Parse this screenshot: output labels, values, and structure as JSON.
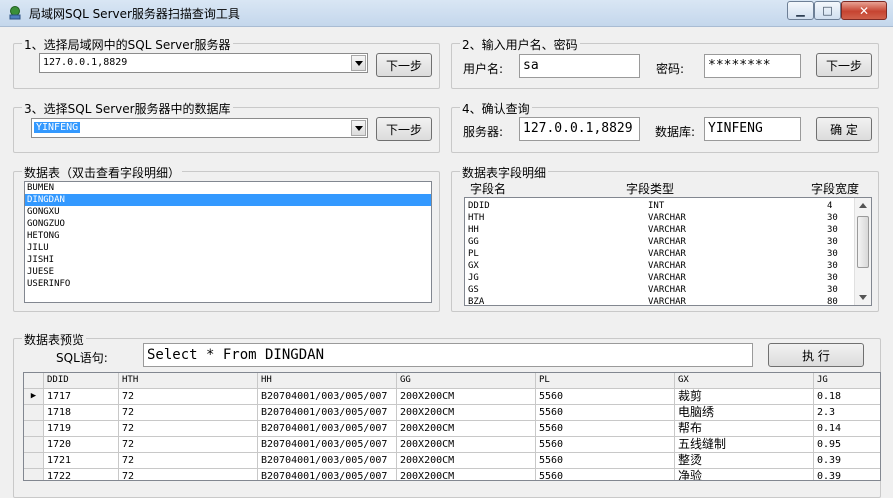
{
  "window": {
    "title": "局域网SQL Server服务器扫描查询工具",
    "min_glyph": "▁",
    "max_glyph": "□",
    "close_glyph": "✕"
  },
  "step1": {
    "label": "1、选择局域网中的SQL Server服务器",
    "server_value": "127.0.0.1,8829",
    "next_label": "下一步"
  },
  "step2": {
    "label": "2、输入用户名、密码",
    "user_label": "用户名:",
    "user_value": "sa",
    "pwd_label": "密码:",
    "pwd_value": "********",
    "next_label": "下一步"
  },
  "step3": {
    "label": "3、选择SQL Server服务器中的数据库",
    "db_value": "YINFENG",
    "next_label": "下一步"
  },
  "step4": {
    "label": "4、确认查询",
    "server_label": "服务器:",
    "server_value": "127.0.0.1,8829",
    "db_label": "数据库:",
    "db_value": "YINFENG",
    "confirm_label": "确 定"
  },
  "tables": {
    "label": "数据表（双击查看字段明细）",
    "items": [
      "BUMEN",
      "DINGDAN",
      "GONGXU",
      "GONGZUO",
      "HETONG",
      "JILU",
      "JISHI",
      "JUESE",
      "USERINFO"
    ],
    "selected": "DINGDAN"
  },
  "fields": {
    "label": "数据表字段明细",
    "headers": [
      "字段名",
      "字段类型",
      "字段宽度"
    ],
    "rows": [
      [
        "DDID",
        "INT",
        "4"
      ],
      [
        "HTH",
        "VARCHAR",
        "30"
      ],
      [
        "HH",
        "VARCHAR",
        "30"
      ],
      [
        "GG",
        "VARCHAR",
        "30"
      ],
      [
        "PL",
        "VARCHAR",
        "30"
      ],
      [
        "GX",
        "VARCHAR",
        "30"
      ],
      [
        "JG",
        "VARCHAR",
        "30"
      ],
      [
        "GS",
        "VARCHAR",
        "30"
      ],
      [
        "BZA",
        "VARCHAR",
        "80"
      ]
    ]
  },
  "preview": {
    "label": "数据表预览",
    "sql_label": "SQL语句:",
    "sql_value": "Select * From DINGDAN",
    "execute_label": "执 行",
    "current_row_marker": "▶",
    "columns": [
      "DDID",
      "HTH",
      "HH",
      "GG",
      "PL",
      "GX",
      "JG"
    ],
    "rows": [
      [
        "1717",
        "72",
        "B20704001/003/005/007",
        "200X200CM",
        "5560",
        "裁剪",
        "0.18"
      ],
      [
        "1718",
        "72",
        "B20704001/003/005/007",
        "200X200CM",
        "5560",
        "电脑绣",
        "2.3"
      ],
      [
        "1719",
        "72",
        "B20704001/003/005/007",
        "200X200CM",
        "5560",
        "帮布",
        "0.14"
      ],
      [
        "1720",
        "72",
        "B20704001/003/005/007",
        "200X200CM",
        "5560",
        "五线缝制",
        "0.95"
      ],
      [
        "1721",
        "72",
        "B20704001/003/005/007",
        "200X200CM",
        "5560",
        "整烫",
        "0.39"
      ],
      [
        "1722",
        "72",
        "B20704001/003/005/007",
        "200X200CM",
        "5560",
        "净验",
        "0.39"
      ]
    ]
  }
}
